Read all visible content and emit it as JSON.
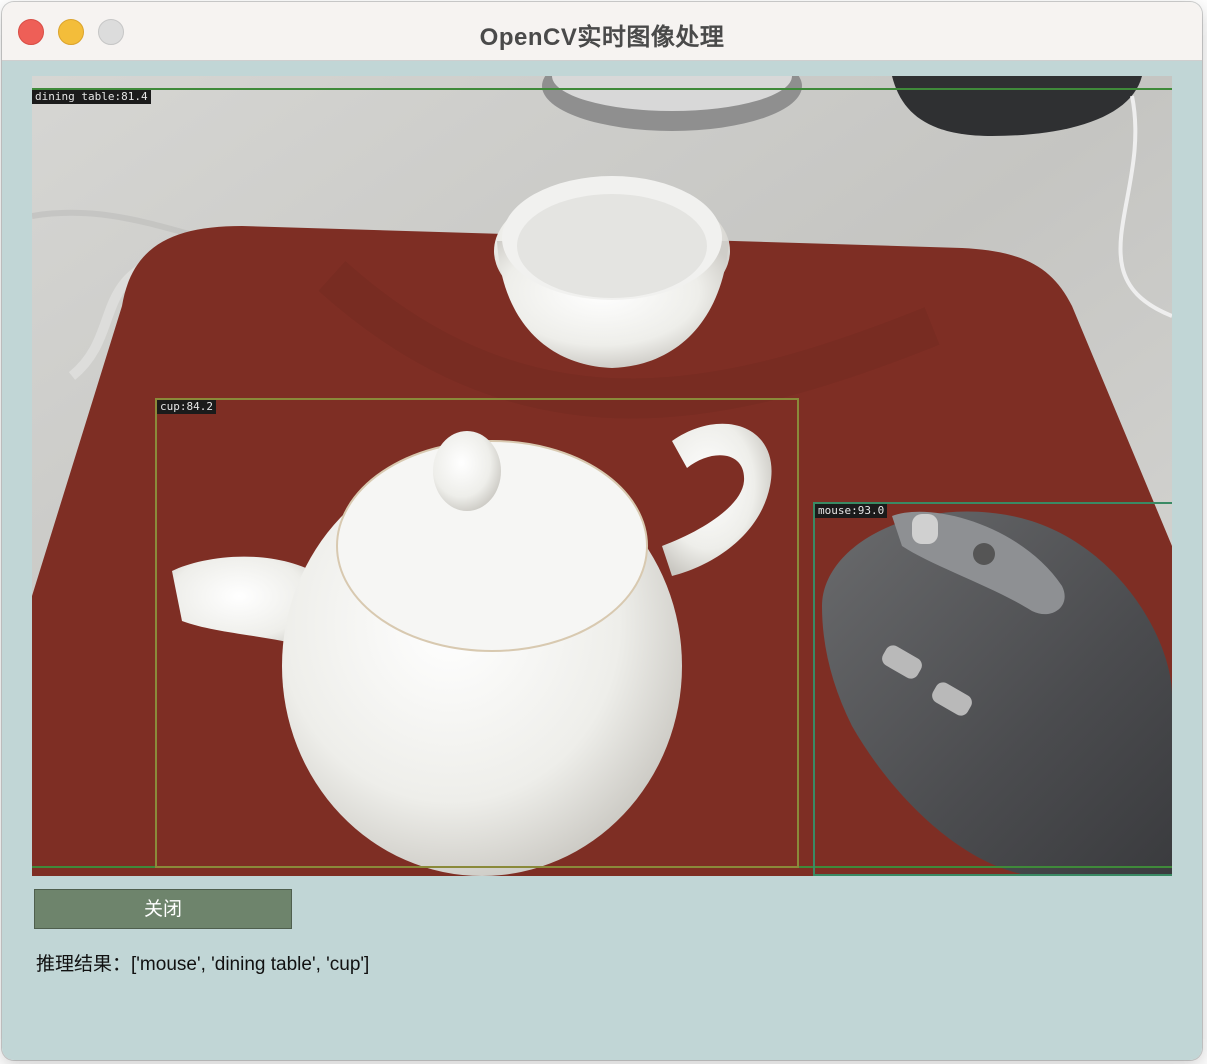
{
  "window": {
    "title": "OpenCV实时图像处理"
  },
  "detections": [
    {
      "label": "dining table:81.4",
      "color": "#3f8a3a"
    },
    {
      "label": "cup:84.2",
      "color": "#8a8a3a"
    },
    {
      "label": "mouse:93.0",
      "color": "#3a8a64"
    }
  ],
  "controls": {
    "close_label": "关闭"
  },
  "result": {
    "prefix": "推理结果：",
    "value": "['mouse', 'dining table', 'cup']"
  }
}
